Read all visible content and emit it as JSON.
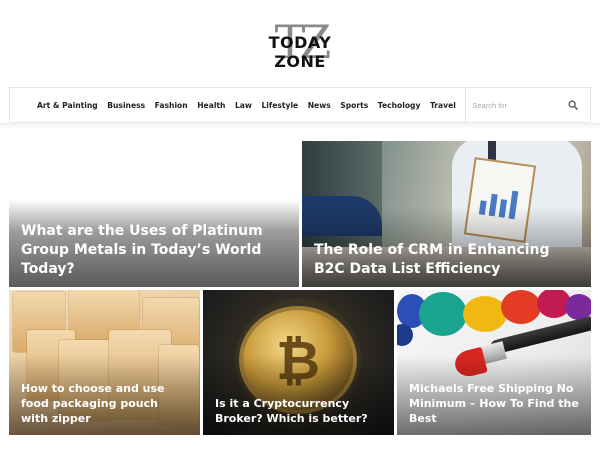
{
  "logo": {
    "mark": "TZ",
    "text": "TODAY ZONE"
  },
  "nav": {
    "items": [
      "Art & Painting",
      "Business",
      "Fashion",
      "Health",
      "Law",
      "Lifestyle",
      "News",
      "Sports",
      "Techology",
      "Travel"
    ],
    "search_placeholder": "Search for"
  },
  "icons": {
    "search": "search-icon"
  },
  "articles": [
    {
      "title": "What are the Uses of Platinum Group Metals in Today’s World Today?"
    },
    {
      "title": "The Role of CRM in Enhancing B2C Data List Efficiency"
    },
    {
      "title": "How to choose and use food packaging pouch with zipper"
    },
    {
      "title": "Is it a Cryptocurrency Broker? Which is better?"
    },
    {
      "title": "Michaels Free Shipping No Minimum – How To Find the Best"
    }
  ]
}
